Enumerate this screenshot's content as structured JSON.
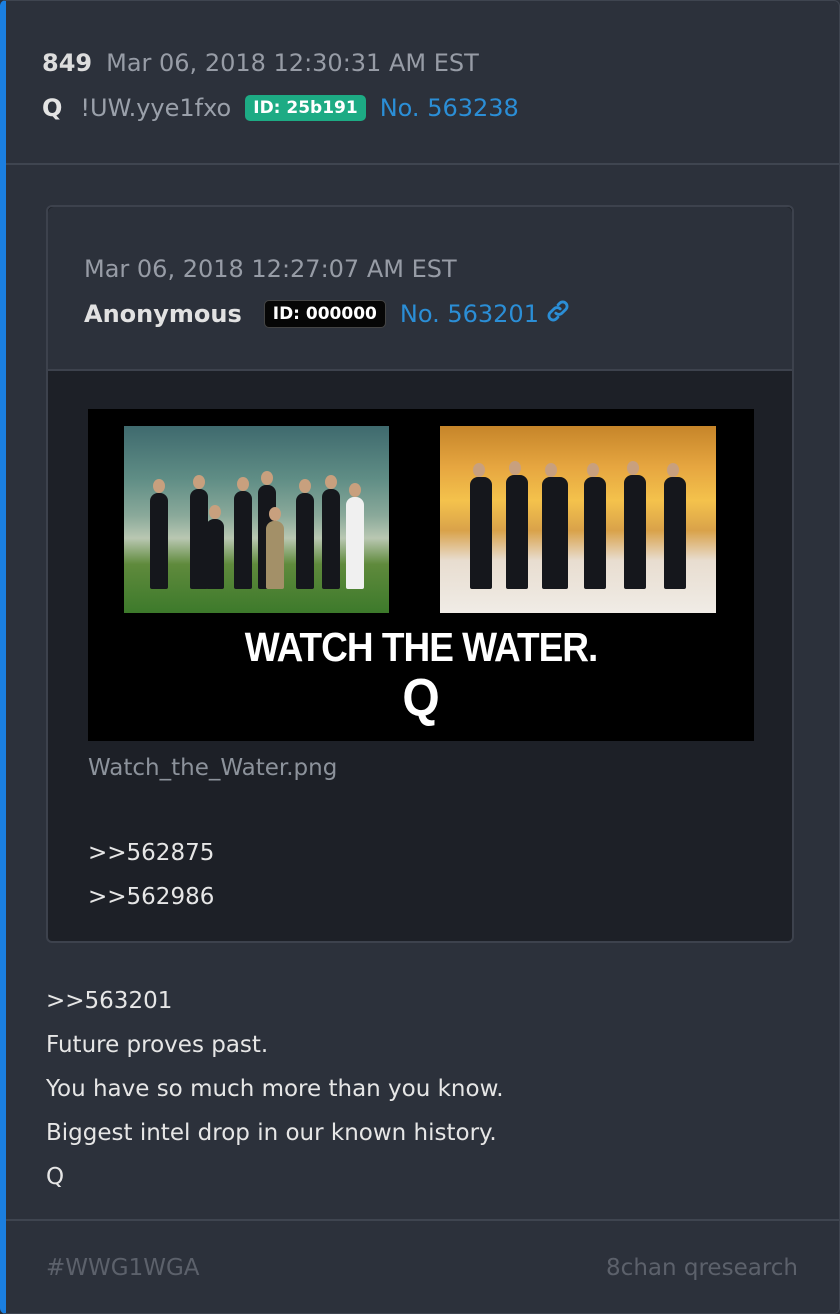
{
  "post": {
    "number": "849",
    "date": "Mar 06, 2018 12:30:31 AM EST",
    "name": "Q",
    "tripcode": "!UW.yye1fxo",
    "id_badge": "ID: 25b191",
    "post_no": "No. 563238",
    "body": [
      ">>563201",
      "Future proves past.",
      "You have so much more than you know.",
      "Biggest intel drop in our known history.",
      "Q"
    ]
  },
  "quoted": {
    "date": "Mar 06, 2018 12:27:07 AM EST",
    "name": "Anonymous",
    "id_badge": "ID: 000000",
    "post_no": "No. 563201",
    "link_icon": "link-icon",
    "image": {
      "caption_line1": "WATCH THE WATER.",
      "caption_line2": "Q",
      "filename": "Watch_the_Water.png"
    },
    "body": [
      ">>562875",
      ">>562986"
    ]
  },
  "footer": {
    "tag": "#WWG1WGA",
    "board": "8chan qresearch"
  },
  "colors": {
    "accent": "#1b7fe0",
    "id_q": "#1dab84",
    "link": "#2b8ed6"
  }
}
